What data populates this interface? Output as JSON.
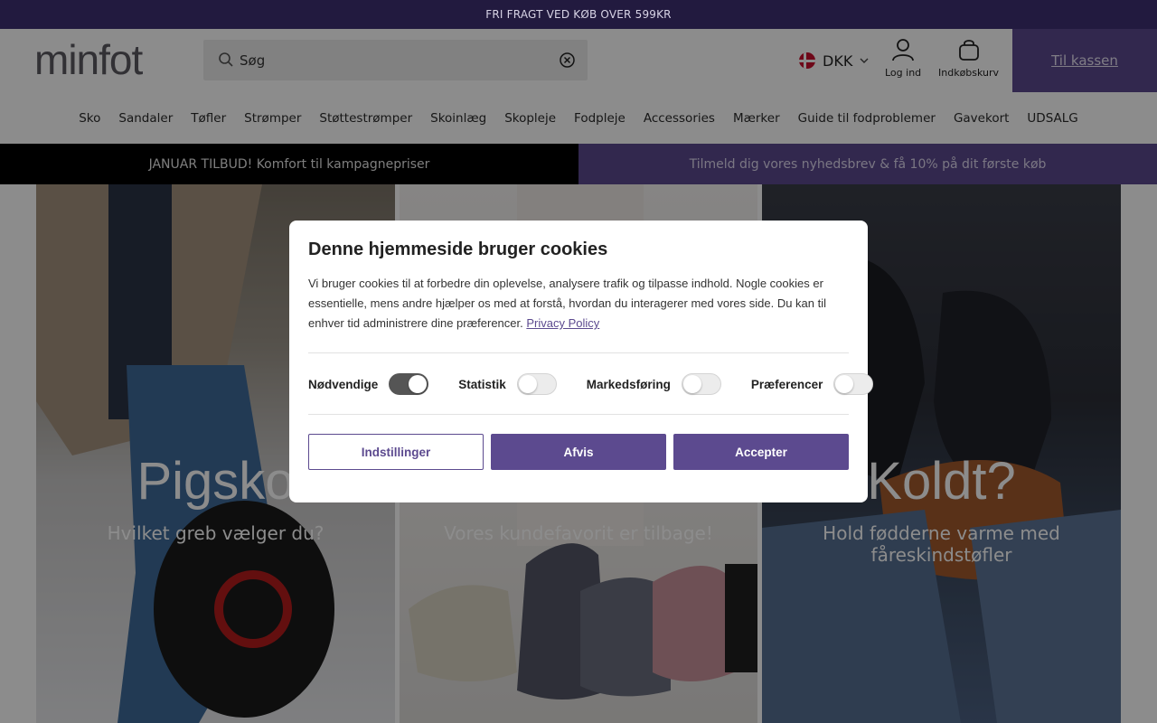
{
  "topbar": {
    "text": "FRI FRAGT VED KØB OVER 599KR"
  },
  "header": {
    "logo_text": "minfot",
    "search": {
      "placeholder": "Søg"
    },
    "currency": "DKK",
    "login_label": "Log ind",
    "cart_label": "Indkøbskurv",
    "checkout_label": "Til kassen"
  },
  "nav": [
    "Sko",
    "Sandaler",
    "Tøfler",
    "Strømper",
    "Støttestrømper",
    "Skoinlæg",
    "Skopleje",
    "Fodpleje",
    "Accessories",
    "Mærker",
    "Guide til fodproblemer",
    "Gavekort",
    "UDSALG"
  ],
  "promo": {
    "left": "JANUAR TILBUD! Komfort til kampagnepriser",
    "right": "Tilmeld dig vores nyhedsbrev & få 10% på dit første køb"
  },
  "tiles": [
    {
      "title": "Pigsko",
      "subtitle": "Hvilket greb vælger du?"
    },
    {
      "title": "",
      "subtitle": "Vores kundefavorit er tilbage!"
    },
    {
      "title": "Koldt?",
      "subtitle": "Hold fødderne varme med fåreskindstøfler"
    }
  ],
  "cookie_modal": {
    "title": "Denne hjemmeside bruger cookies",
    "body": "Vi bruger cookies til at forbedre din oplevelse, analysere trafik og tilpasse indhold. Nogle cookies er essentielle, mens andre hjælper os med at forstå, hvordan du interagerer med vores side. Du kan til enhver tid administrere dine præferencer.",
    "privacy_link": "Privacy Policy",
    "toggles": [
      {
        "label": "Nødvendige",
        "on": true
      },
      {
        "label": "Statistik",
        "on": false
      },
      {
        "label": "Markedsføring",
        "on": false
      },
      {
        "label": "Præferencer",
        "on": false
      }
    ],
    "buttons": {
      "settings": "Indstillinger",
      "decline": "Afvis",
      "accept": "Accepter"
    }
  },
  "colors": {
    "brand_purple": "#5c4a8f",
    "topbar": "#221a3f"
  }
}
